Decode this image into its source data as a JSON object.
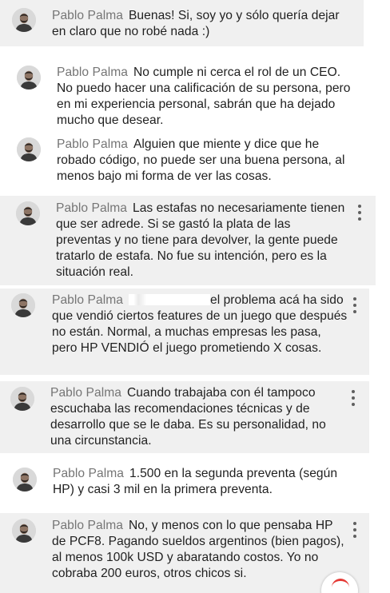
{
  "colors": {
    "author": "#757575",
    "text": "#1f1f1f",
    "shaded_background": "#f0f0f0",
    "menu_icon": "#5f5f5f",
    "fab_accent": "#e53935"
  },
  "comments": [
    {
      "author": "Pablo Palma",
      "text": "Buenas! Si, soy yo y sólo quería dejar en claro que no robé nada :)"
    },
    {
      "author": "Pablo Palma",
      "text": "No cumple ni cerca el rol de un CEO. No puedo hacer una calificación de su persona, pero en mi experiencia personal, sabrán que ha dejado mucho que desear."
    },
    {
      "author": "Pablo Palma",
      "text": "Alguien que miente y dice que he robado código, no puede ser una buena persona, al menos bajo mi forma de ver las cosas."
    },
    {
      "author": "Pablo Palma",
      "text": "Las estafas no necesariamente tienen que ser adrede. Si se gastó la plata de las preventas y no tiene para devolver, la gente puede tratarlo de estafa. No fue su intención, pero es la situación real."
    },
    {
      "author": "Pablo Palma",
      "text": "el problema acá ha sido que vendió ciertos features de un juego que después no están. Normal, a muchas empresas les pasa, pero HP VENDIÓ el juego prometiendo X cosas."
    },
    {
      "author": "Pablo Palma",
      "text": "Cuando trabajaba con él tampoco escuchaba las recomendaciones técnicas y de desarrollo que se le daba. Es su personalidad, no una circunstancia."
    },
    {
      "author": "Pablo Palma",
      "text": "1.500 en la segunda preventa (según HP) y casi 3 mil en la primera preventa."
    },
    {
      "author": "Pablo Palma",
      "text": "No, y menos con lo que pensaba HP de PCF8. Pagando sueldos argentinos (bien pagos), al menos 100k USD y abaratando costos. Yo no cobraba 200 euros, otros chicos si."
    }
  ],
  "icons": {
    "comment_menu": "more-vert-icon",
    "avatar": "profile-photo",
    "floating_button": "fab-icon"
  }
}
